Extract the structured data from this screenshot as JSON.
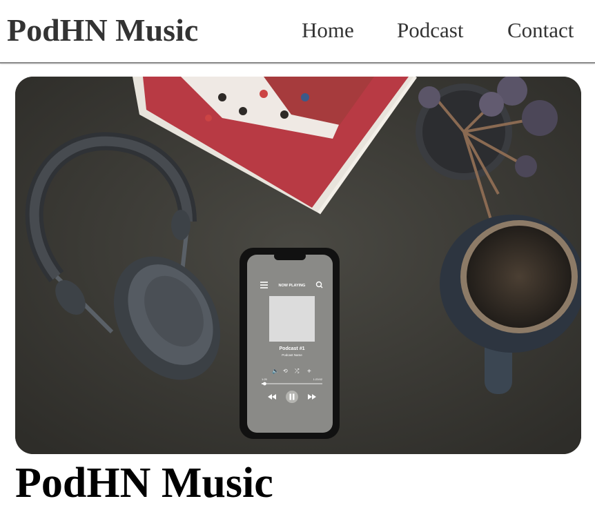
{
  "header": {
    "brand": "PodHN Music",
    "nav": [
      {
        "label": "Home"
      },
      {
        "label": "Podcast"
      },
      {
        "label": "Contact"
      }
    ]
  },
  "hero": {
    "phone_screen": {
      "header_text": "NOW PLAYING",
      "track_title": "Podcast #1",
      "track_subtitle": "Podcast Name",
      "time_elapsed": "1:25",
      "time_total": "1:23:52",
      "progress": 0.05
    }
  },
  "main": {
    "heading": "PodHN Music"
  },
  "colors": {
    "nav_text": "#333333",
    "heading_text": "#000000",
    "hero_background": "#3d3c37"
  }
}
